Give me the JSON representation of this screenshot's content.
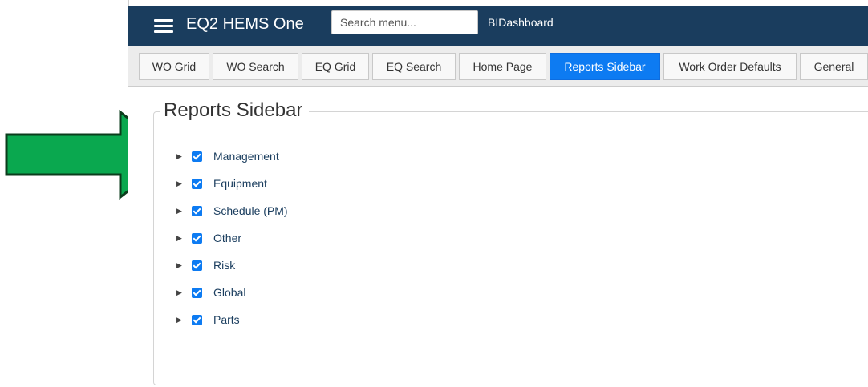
{
  "header": {
    "app_title": "EQ2 HEMS One",
    "search_placeholder": "Search menu...",
    "bi_link": "BIDashboard",
    "bg_color": "#1a3d5e"
  },
  "tabs": [
    {
      "label": "WO Grid",
      "active": false
    },
    {
      "label": "WO Search",
      "active": false
    },
    {
      "label": "EQ Grid",
      "active": false
    },
    {
      "label": "EQ Search",
      "active": false
    },
    {
      "label": "Home Page",
      "active": false
    },
    {
      "label": "Reports Sidebar",
      "active": true
    },
    {
      "label": "Work Order Defaults",
      "active": false
    },
    {
      "label": "General",
      "active": false
    }
  ],
  "section": {
    "title": "Reports Sidebar",
    "items": [
      {
        "label": "Management",
        "checked": true
      },
      {
        "label": "Equipment",
        "checked": true
      },
      {
        "label": "Schedule (PM)",
        "checked": true
      },
      {
        "label": "Other",
        "checked": true
      },
      {
        "label": "Risk",
        "checked": true
      },
      {
        "label": "Global",
        "checked": true
      },
      {
        "label": "Parts",
        "checked": true
      }
    ]
  },
  "colors": {
    "accent": "#0d7bf2",
    "annotation_arrow": "#0aa84f"
  },
  "annotation": {
    "icon": "green-arrow-icon"
  }
}
